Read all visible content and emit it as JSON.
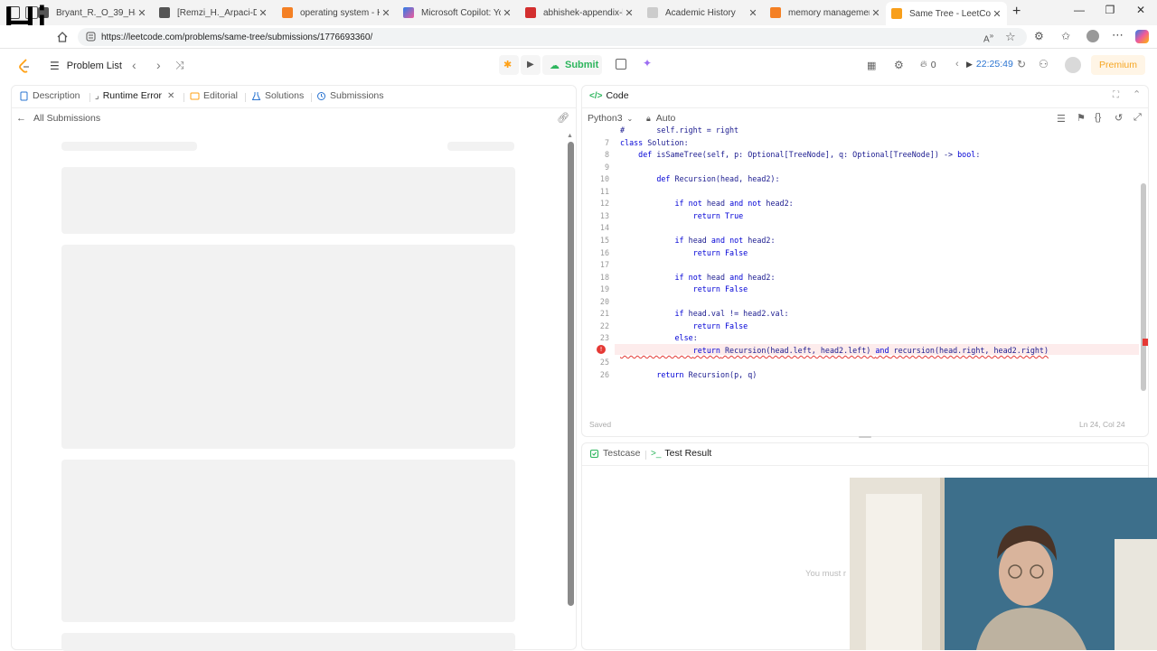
{
  "overlay_text": "Hi",
  "browser": {
    "tabs": [
      {
        "title": "Bryant_R._O_39_Hallan",
        "favicon_color": "#555555",
        "active": false
      },
      {
        "title": "[Remzi_H._Arpaci-Duss",
        "favicon_color": "#555555",
        "active": false
      },
      {
        "title": "operating system - Ho",
        "favicon_color": "#f48024",
        "active": false
      },
      {
        "title": "Microsoft Copilot: You",
        "favicon_color": "#2b7de9",
        "active": false
      },
      {
        "title": "abhishek-appendix-l.p",
        "favicon_color": "#d32f2f",
        "active": false
      },
      {
        "title": "Academic History",
        "favicon_color": "#888888",
        "active": false
      },
      {
        "title": "memory management",
        "favicon_color": "#f48024",
        "active": false
      },
      {
        "title": "Same Tree - LeetCode",
        "favicon_color": "#f89f1b",
        "active": true
      }
    ],
    "url": "https://leetcode.com/problems/same-tree/submissions/1776693360/"
  },
  "header": {
    "problem_list": "Problem List",
    "submit": "Submit",
    "streak": "0",
    "timer": "22:25:49",
    "premium": "Premium"
  },
  "left_panel": {
    "tabs": [
      {
        "label": "Description",
        "active": false
      },
      {
        "label": "Runtime Error",
        "active": true
      },
      {
        "label": "Editorial",
        "active": false
      },
      {
        "label": "Solutions",
        "active": false
      },
      {
        "label": "Submissions",
        "active": false
      }
    ],
    "back_link": "All Submissions"
  },
  "code_panel": {
    "title": "Code",
    "language": "Python3",
    "mode": "Auto",
    "status": "Saved",
    "cursor": "Ln 24, Col 24",
    "lines": [
      {
        "n": "",
        "text": "#       self.right = right"
      },
      {
        "n": "7",
        "text": "class Solution:"
      },
      {
        "n": "8",
        "text": "    def isSameTree(self, p: Optional[TreeNode], q: Optional[TreeNode]) -> bool:"
      },
      {
        "n": "9",
        "text": ""
      },
      {
        "n": "10",
        "text": "        def Recursion(head, head2):"
      },
      {
        "n": "11",
        "text": ""
      },
      {
        "n": "12",
        "text": "            if not head and not head2:"
      },
      {
        "n": "13",
        "text": "                return True"
      },
      {
        "n": "14",
        "text": ""
      },
      {
        "n": "15",
        "text": "            if head and not head2:"
      },
      {
        "n": "16",
        "text": "                return False"
      },
      {
        "n": "17",
        "text": ""
      },
      {
        "n": "18",
        "text": "            if not head and head2:"
      },
      {
        "n": "19",
        "text": "                return False"
      },
      {
        "n": "20",
        "text": ""
      },
      {
        "n": "21",
        "text": "            if head.val != head2.val:"
      },
      {
        "n": "22",
        "text": "                return False"
      },
      {
        "n": "23",
        "text": "            else:"
      },
      {
        "n": "",
        "text": "                return Recursion(head.left, head2.left) and recursion(head.right, head2.right)"
      },
      {
        "n": "25",
        "text": ""
      },
      {
        "n": "26",
        "text": "        return Recursion(p, q)"
      }
    ]
  },
  "bottom_panel": {
    "tabs": [
      {
        "label": "Testcase",
        "active": false
      },
      {
        "label": "Test Result",
        "active": true
      }
    ],
    "hint": "You must r"
  },
  "colors": {
    "accent_orange": "#ffa116",
    "submit_green": "#2db55d",
    "error_red": "#e53935",
    "premium_bg": "#fff5e6",
    "premium_text": "#f5a623"
  }
}
